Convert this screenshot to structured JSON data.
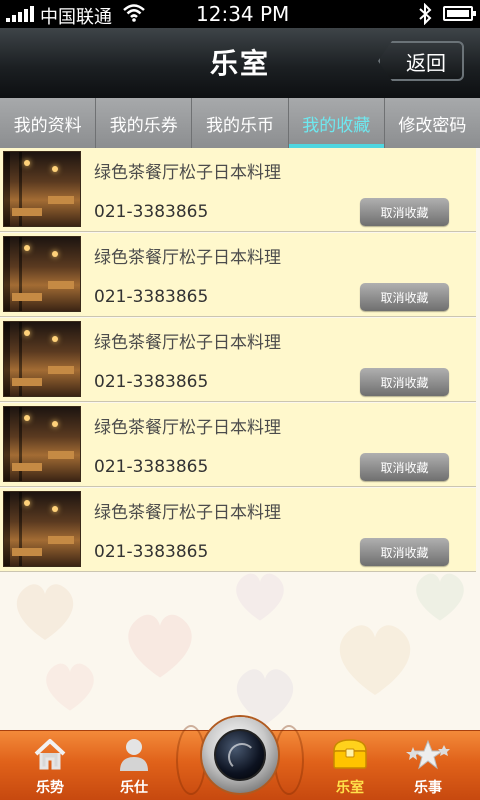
{
  "status_bar": {
    "carrier": "中国联通",
    "time": "12:34 PM",
    "icons": [
      "signal-icon",
      "wifi-icon",
      "bluetooth-icon",
      "battery-icon"
    ]
  },
  "header": {
    "title": "乐室",
    "back_label": "返回"
  },
  "tabs": [
    {
      "label": "我的资料",
      "active": false
    },
    {
      "label": "我的乐券",
      "active": false
    },
    {
      "label": "我的乐币",
      "active": false
    },
    {
      "label": "我的收藏",
      "active": true
    },
    {
      "label": "修改密码",
      "active": false
    }
  ],
  "favorites": [
    {
      "name": "绿色茶餐厅松子日本料理",
      "phone": "021-3383865",
      "action": "取消收藏"
    },
    {
      "name": "绿色茶餐厅松子日本料理",
      "phone": "021-3383865",
      "action": "取消收藏"
    },
    {
      "name": "绿色茶餐厅松子日本料理",
      "phone": "021-3383865",
      "action": "取消收藏"
    },
    {
      "name": "绿色茶餐厅松子日本料理",
      "phone": "021-3383865",
      "action": "取消收藏"
    },
    {
      "name": "绿色茶餐厅松子日本料理",
      "phone": "021-3383865",
      "action": "取消收藏"
    }
  ],
  "bottom_nav": [
    {
      "label": "乐势",
      "icon": "house-icon",
      "active": false
    },
    {
      "label": "乐仕",
      "icon": "person-icon",
      "active": false
    },
    {
      "label": "",
      "icon": "camera-icon",
      "active": false
    },
    {
      "label": "乐室",
      "icon": "treasure-chest-icon",
      "active": true
    },
    {
      "label": "乐事",
      "icon": "stars-icon",
      "active": false
    }
  ],
  "colors": {
    "accent_tab": "#4fd6e0",
    "row_bg": "#fff8cc",
    "nav_orange": "#e0621a",
    "nav_active_label": "#ffe14a"
  }
}
